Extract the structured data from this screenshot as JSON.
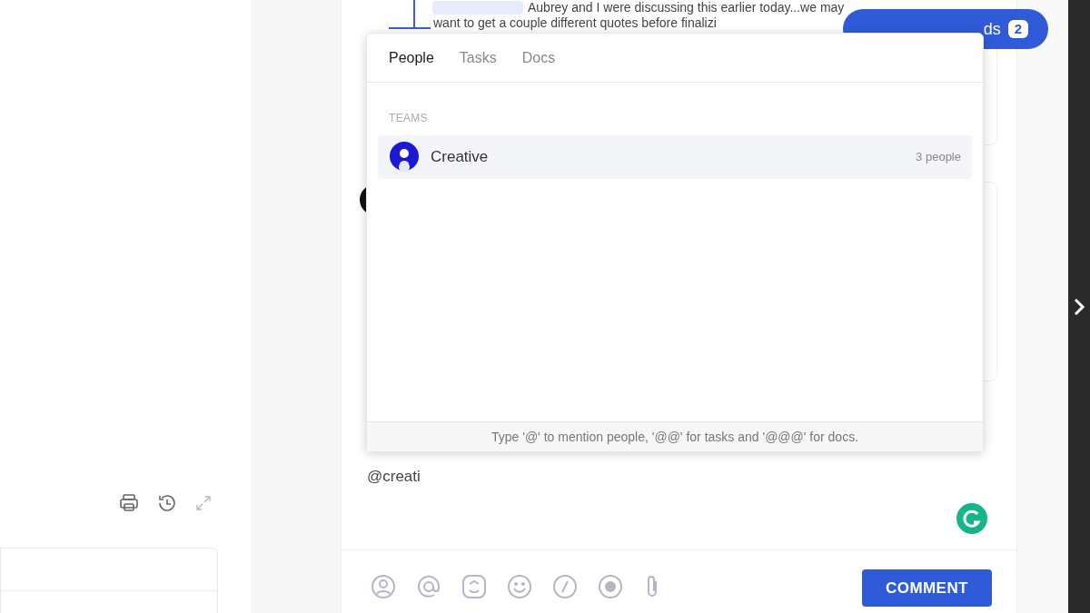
{
  "thread": {
    "lines": [
      "Aubrey and I were discussing this earlier today...we may",
      "want to get a couple different quotes before finalizi"
    ]
  },
  "threads_pill": {
    "label": "ds",
    "count": "2"
  },
  "mention_popup": {
    "tabs": [
      {
        "label": "People",
        "selected": true
      },
      {
        "label": "Tasks",
        "selected": false
      },
      {
        "label": "Docs",
        "selected": false
      }
    ],
    "section": "TEAMS",
    "items": [
      {
        "name": "Creative",
        "count": "3 people",
        "selected": true
      }
    ],
    "hint": "Type '@' to mention people, '@@' for tasks and '@@@' for docs."
  },
  "comment_box": {
    "value": "@creati",
    "submit": "COMMENT"
  }
}
